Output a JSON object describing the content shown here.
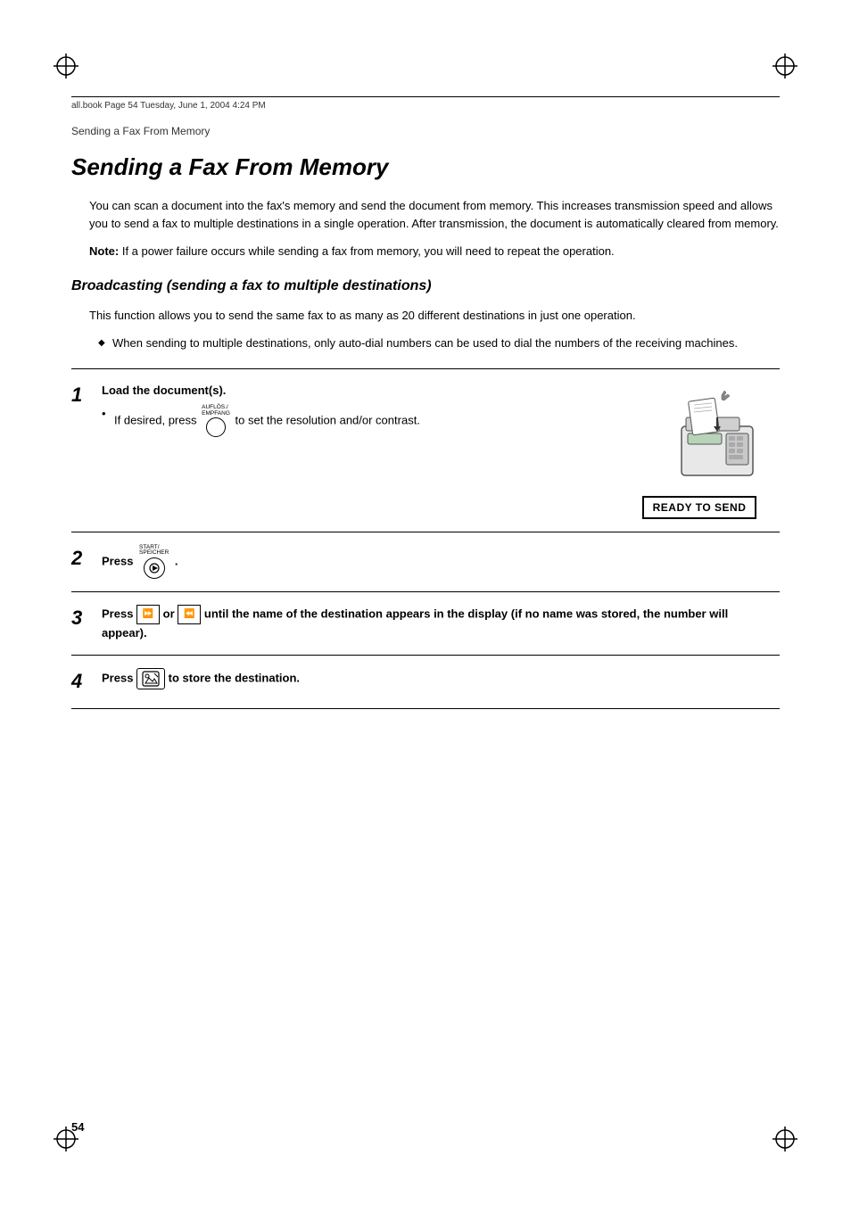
{
  "header": {
    "file_info": "all.book   Page 54   Tuesday, June 1, 2004   4:24 PM"
  },
  "breadcrumb": "Sending a Fax From Memory",
  "page_title": "Sending a Fax From Memory",
  "intro_text": "You can scan a document into the fax's memory and send the document from memory. This increases transmission speed and allows you to send a fax to multiple destinations in a single operation. After transmission, the document is automatically cleared from memory.",
  "note": {
    "label": "Note:",
    "text": "If a power failure occurs while sending a fax from memory, you will need to repeat the operation."
  },
  "subsection_title": "Broadcasting (sending a fax to multiple destinations)",
  "subsection_body": "This function allows you to send the same fax to as many as 20 different destinations in just one operation.",
  "bullet_item": "When sending to multiple destinations, only auto-dial numbers can be used to dial the numbers of the receiving machines.",
  "steps": [
    {
      "number": "1",
      "title": "Load the document(s).",
      "bullet": "If desired, press",
      "bullet_middle": "to set the resolution and/or contrast.",
      "button_label_top": "AUFLÖS./EMPFANG",
      "has_image": true,
      "ready_to_send": "READY TO SEND"
    },
    {
      "number": "2",
      "title": "Press",
      "title_suffix": ".",
      "button_label_top": "START/SPEICHER",
      "has_image": false
    },
    {
      "number": "3",
      "text_bold": "Press",
      "text_middle": "or",
      "text_end": "until the name of the destination appears in the display (if no name was stored, the number will appear).",
      "has_image": false
    },
    {
      "number": "4",
      "text_bold": "Press",
      "text_end": "to store the destination.",
      "has_image": false
    }
  ],
  "page_number": "54",
  "icons": {
    "resolution_btn": "○",
    "start_btn": "▶",
    "arrow_forward": "▶▶",
    "arrow_back": "◀◀",
    "store_btn": "✎"
  }
}
